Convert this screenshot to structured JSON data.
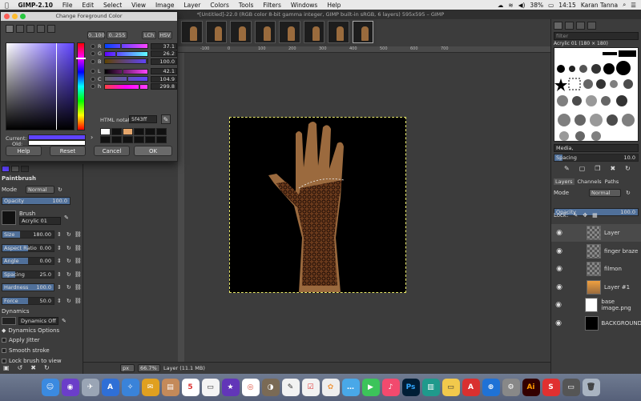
{
  "menubar": {
    "app_name": "GIMP-2.10",
    "items": [
      "File",
      "Edit",
      "Select",
      "View",
      "Image",
      "Layer",
      "Colors",
      "Tools",
      "Filters",
      "Windows",
      "Help"
    ],
    "battery": "38%",
    "time": "14:15",
    "user": "Karan Tanna"
  },
  "window_title": "*[Untitled]-22.0 (RGB color 8-bit gamma integer, GIMP built-in sRGB, 6 layers) 595x595 – GIMP",
  "dialog": {
    "title": "Change Foreground Color",
    "range_buttons": [
      "0..100",
      "0..255"
    ],
    "mode_buttons": [
      "LCh",
      "HSV"
    ],
    "sliders": [
      {
        "label": "R",
        "value": "37.1",
        "fraction": 0.371,
        "gradient": "linear-gradient(to right,#0043ff,#ff43ff)"
      },
      {
        "label": "G",
        "value": "26.2",
        "fraction": 0.262,
        "gradient": "linear-gradient(to right,#5f00ff,#5fffff)"
      },
      {
        "label": "B",
        "value": "100.0",
        "fraction": 1.0,
        "gradient": "linear-gradient(to right,#5f4300,#5f43ff)"
      },
      {
        "label": "L",
        "value": "42.1",
        "fraction": 0.421,
        "gradient": "linear-gradient(to right,#000,#ff44ff)"
      },
      {
        "label": "C",
        "value": "104.9",
        "fraction": 0.52,
        "gradient": "linear-gradient(to right,#666,#5f43ff)"
      },
      {
        "label": "h",
        "value": "299.8",
        "fraction": 0.83,
        "gradient": "linear-gradient(to right,#ff4040,#ff00ff,#ff40ff)"
      }
    ],
    "html_label": "HTML notation:",
    "html_value": "5f43ff",
    "current_label": "Current:",
    "old_label": "Old:",
    "current_color": "#5f43ff",
    "old_color": "#ffffff",
    "buttons": {
      "help": "Help",
      "reset": "Reset",
      "cancel": "Cancel",
      "ok": "OK"
    }
  },
  "toolbox": {
    "panel_title": "Paintbrush",
    "mode_label": "Mode",
    "mode_value": "Normal",
    "opacity_label": "Opacity",
    "opacity_value": "100.0",
    "brush_label": "Brush",
    "brush_value": "Acrylic 01",
    "options": [
      {
        "label": "Size",
        "value": "180.00",
        "fraction": 0.35
      },
      {
        "label": "Aspect Ratio",
        "value": "0.00",
        "fraction": 0.5
      },
      {
        "label": "Angle",
        "value": "0.00",
        "fraction": 0.5
      },
      {
        "label": "Spacing",
        "value": "25.0",
        "fraction": 0.25
      },
      {
        "label": "Hardness",
        "value": "100.0",
        "fraction": 1.0
      },
      {
        "label": "Force",
        "value": "50.0",
        "fraction": 0.5
      }
    ],
    "dynamics_label": "Dynamics",
    "dynamics_value": "Dynamics Off",
    "dynamics_options": "Dynamics Options",
    "apply_jitter": "Apply Jitter",
    "smooth_stroke": "Smooth stroke",
    "lock_brush": "Lock brush to view"
  },
  "right_panel": {
    "filter_placeholder": "filter",
    "brush_name": "Acrylic 01 (180 × 180)",
    "media_label": "Media,",
    "spacing_label": "Spacing",
    "spacing_value": "10.0",
    "tabs": [
      "Layers",
      "Channels",
      "Paths"
    ],
    "mode_label": "Mode",
    "mode_value": "Normal",
    "opacity_label": "Opacity",
    "opacity_value": "100.0",
    "lock_label": "Lock:",
    "layers": [
      {
        "name": "Layer",
        "thumb": "checker"
      },
      {
        "name": "finger braze",
        "thumb": "checker"
      },
      {
        "name": "filmon",
        "thumb": "checker"
      },
      {
        "name": "Layer #1",
        "thumb": "hand"
      },
      {
        "name": "base image.png",
        "thumb": "white"
      },
      {
        "name": "BACKGROUND",
        "thumb": "black"
      }
    ]
  },
  "statusbar": {
    "unit": "px",
    "zoom": "66.7%",
    "info": "Layer (11.1 MB)"
  },
  "ruler_ticks": [
    "-100",
    "0",
    "100",
    "200",
    "300",
    "400",
    "500",
    "600",
    "700"
  ],
  "dock": {
    "calendar_day": "5"
  }
}
